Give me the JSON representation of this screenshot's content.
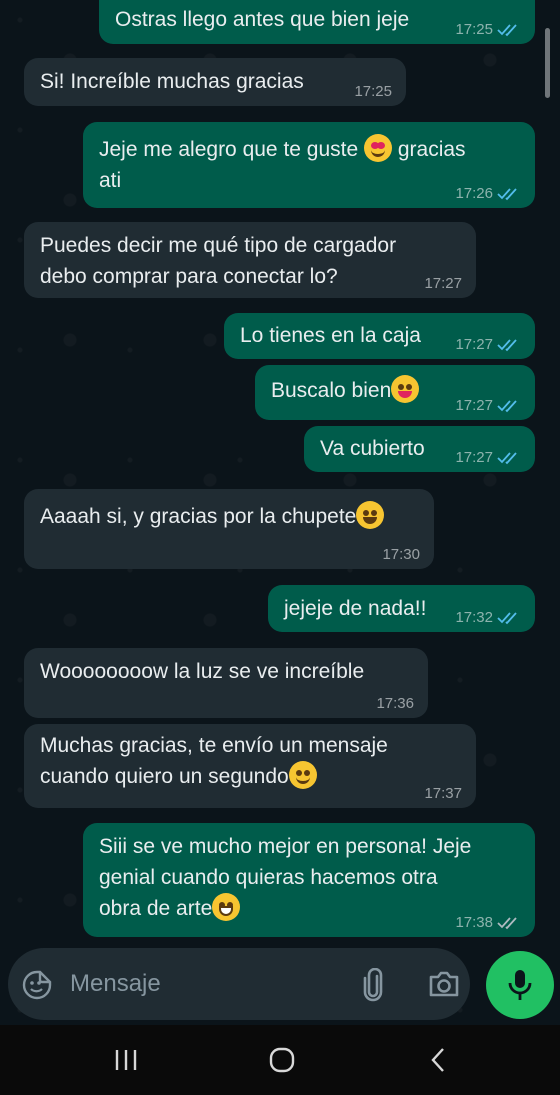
{
  "messages": [
    {
      "text": "Ostras llego antes que bien jeje",
      "time": "17:25",
      "dir": "out",
      "read": true
    },
    {
      "text": "Si! Increíble muchas gracias",
      "time": "17:25",
      "dir": "in"
    },
    {
      "text_a": "Jeje me alegro que te guste ",
      "text_b": " gracias",
      "text_c": "ati",
      "time": "17:26",
      "dir": "out",
      "read": true
    },
    {
      "line1": "Puedes decir me qué tipo de cargador",
      "line2": "debo comprar para conectar lo?",
      "time": "17:27",
      "dir": "in"
    },
    {
      "text": "Lo tienes en la caja",
      "time": "17:27",
      "dir": "out",
      "read": true
    },
    {
      "text": "Buscalo bien",
      "time": "17:27",
      "dir": "out",
      "read": true
    },
    {
      "text": "Va cubierto",
      "time": "17:27",
      "dir": "out",
      "read": true
    },
    {
      "text": "Aaaah si, y gracias por la chupete",
      "time": "17:30",
      "dir": "in"
    },
    {
      "text": "jejeje de nada!!",
      "time": "17:32",
      "dir": "out",
      "read": true
    },
    {
      "text": "Woooooooow la luz se ve increíble",
      "time": "17:36",
      "dir": "in"
    },
    {
      "line1": "Muchas gracias, te envío un mensaje",
      "line2": "cuando quiero un segundo",
      "time": "17:37",
      "dir": "in"
    },
    {
      "line1": "Siii se ve mucho mejor en persona! Jeje",
      "line2": "genial cuando quieras hacemos otra",
      "line3": "obra de arte",
      "time": "17:38",
      "dir": "out",
      "read": false
    }
  ],
  "composer": {
    "placeholder": "Mensaje"
  },
  "icons": {
    "emoji_button": "sticker-smile-icon",
    "attach": "paperclip-icon",
    "camera": "camera-icon",
    "mic": "microphone-icon",
    "nav_recents": "recents-icon",
    "nav_home": "home-icon",
    "nav_back": "back-icon"
  },
  "colors": {
    "outgoing_bubble": "#005c4b",
    "incoming_bubble": "#202c33",
    "read_ticks": "#53bdeb",
    "mic_button": "#21c063",
    "background": "#0b141a"
  }
}
